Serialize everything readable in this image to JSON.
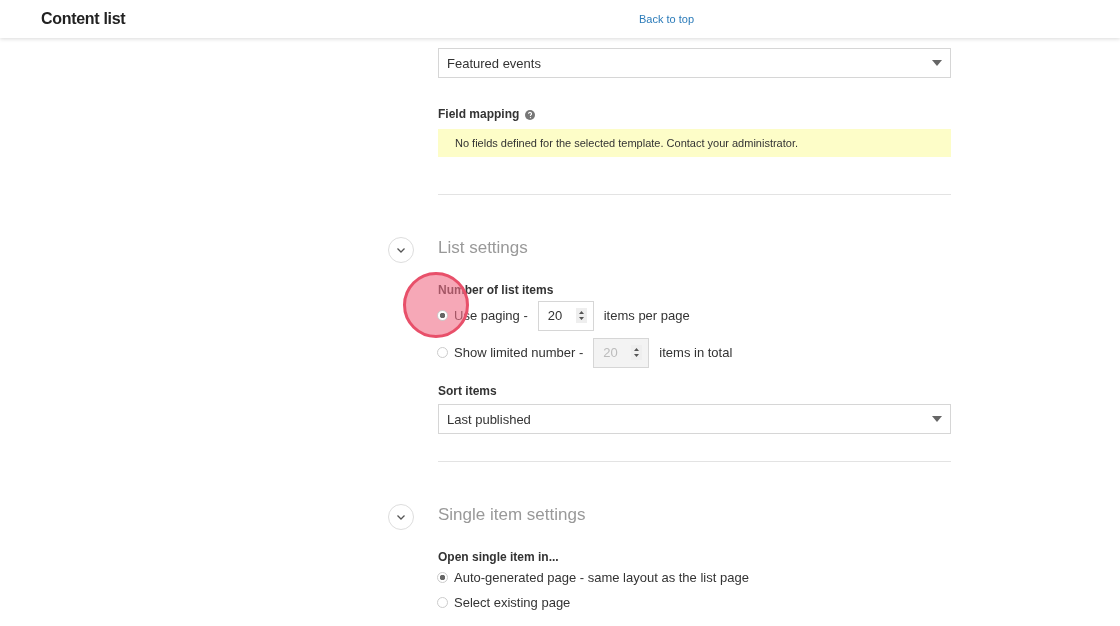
{
  "header": {
    "title": "Content list",
    "back_link": "Back to top"
  },
  "template": {
    "value": "Featured events"
  },
  "field_mapping": {
    "label": "Field mapping",
    "notice": "No fields defined for the selected template. Contact your administrator."
  },
  "sections": [
    {
      "title": "List settings",
      "fields": [
        {
          "kind": "radios",
          "label": "Number of list items",
          "options": [
            {
              "before": "Use paging -",
              "number": "20",
              "after": "items per page",
              "selected": true
            },
            {
              "before": "Show limited number -",
              "number": "20",
              "after": "items in total",
              "selected": false
            }
          ]
        },
        {
          "kind": "select",
          "label": "Sort items",
          "value": "Last published"
        }
      ]
    },
    {
      "title": "Single item settings",
      "fields": [
        {
          "kind": "radios",
          "label": "Open single item in...",
          "options": [
            {
              "text": "Auto-generated page - same layout as the list page",
              "selected": true
            },
            {
              "text": "Select existing page",
              "selected": false
            }
          ]
        }
      ]
    }
  ],
  "click_marker": true
}
